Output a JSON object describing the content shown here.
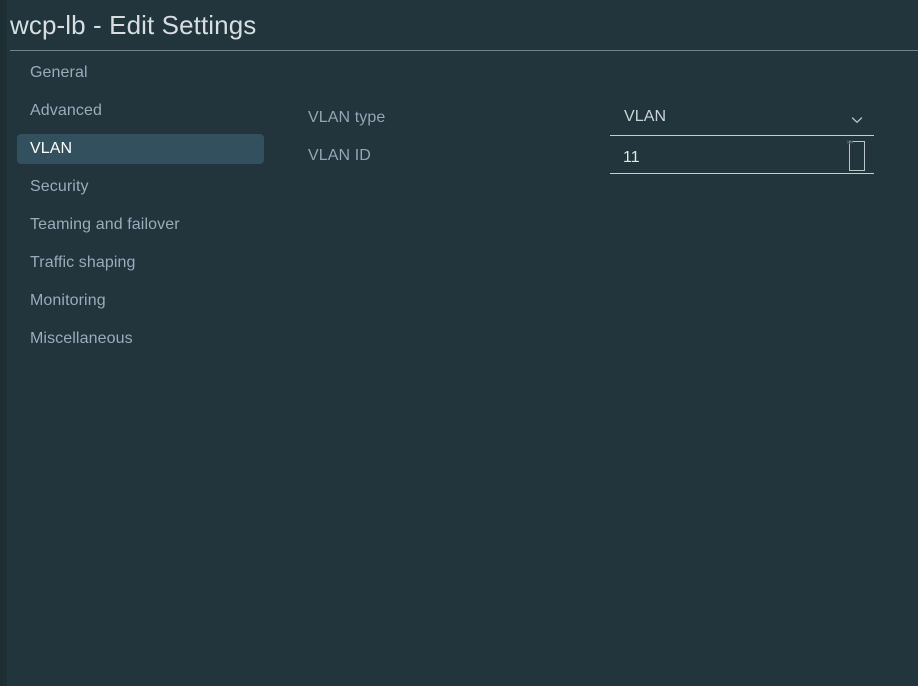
{
  "dialog": {
    "title": "wcp-lb - Edit Settings"
  },
  "sidebar": {
    "items": [
      {
        "label": "General",
        "selected": false
      },
      {
        "label": "Advanced",
        "selected": false
      },
      {
        "label": "VLAN",
        "selected": true
      },
      {
        "label": "Security",
        "selected": false
      },
      {
        "label": "Teaming and failover",
        "selected": false
      },
      {
        "label": "Traffic shaping",
        "selected": false
      },
      {
        "label": "Monitoring",
        "selected": false
      },
      {
        "label": "Miscellaneous",
        "selected": false
      }
    ]
  },
  "form": {
    "vlan_type": {
      "label": "VLAN type",
      "value": "VLAN",
      "icon": "chevron-down-icon"
    },
    "vlan_id": {
      "label": "VLAN ID",
      "value": "11",
      "placeholder": "",
      "icon": "number-spinner-icon"
    }
  },
  "colors": {
    "background": "#22343c",
    "edge_strip": "#1d2e35",
    "selection": "#33505e",
    "label_text": "#90a7b1",
    "value_text": "#c9d4d9",
    "title_text": "#d6dee2",
    "selected_text": "#ffffff",
    "rule": "#6e8490",
    "underline": "#c3ced3"
  }
}
